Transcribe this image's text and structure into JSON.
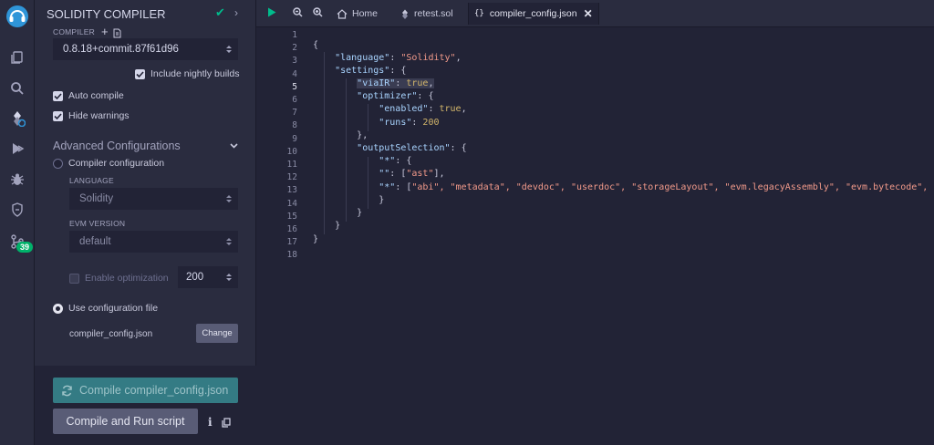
{
  "sidebar": {
    "title": "SOLIDITY COMPILER",
    "compiler_label": "COMPILER",
    "compiler_version": "0.8.18+commit.87f61d96",
    "include_nightly": "Include nightly builds",
    "auto_compile": "Auto compile",
    "hide_warnings": "Hide warnings",
    "advanced_title": "Advanced Configurations",
    "compiler_configuration": "Compiler configuration",
    "language_label": "LANGUAGE",
    "language_value": "Solidity",
    "evm_label": "EVM VERSION",
    "evm_value": "default",
    "enable_optimization": "Enable optimization",
    "runs_value": "200",
    "use_config_file": "Use configuration file",
    "config_file_name": "compiler_config.json",
    "change_button": "Change",
    "compile_button": "Compile compiler_config.json",
    "compile_run_button": "Compile and Run script"
  },
  "rail": {
    "badge_count": "39"
  },
  "editor": {
    "tabs": {
      "home": "Home",
      "retest": "retest.sol",
      "config": "compiler_config.json"
    },
    "line_numbers": [
      "1",
      "2",
      "3",
      "4",
      "5",
      "6",
      "7",
      "8",
      "9",
      "10",
      "11",
      "12",
      "13",
      "14",
      "15",
      "16",
      "17",
      "18"
    ],
    "code": {
      "l2_brace": "{",
      "l3_key": "\"language\"",
      "l3_val": "\"Solidity\"",
      "l4_key": "\"settings\"",
      "l5_key": "\"viaIR\"",
      "l5_val": "true",
      "l6_key": "\"optimizer\"",
      "l7_key": "\"enabled\"",
      "l7_val": "true",
      "l8_key": "\"runs\"",
      "l8_val": "200",
      "l9": "},",
      "l10_key": "\"outputSelection\"",
      "l11_key": "\"*\"",
      "l12_key": "\"\"",
      "l12_val": "\"ast\"",
      "l13_key": "\"*\"",
      "l13_vals": "\"abi\", \"metadata\", \"devdoc\", \"userdoc\", \"storageLayout\", \"evm.legacyAssembly\", \"evm.bytecode\", \"evm",
      "l14": "}",
      "l15": "}",
      "l16": "}",
      "l17": "}"
    }
  }
}
